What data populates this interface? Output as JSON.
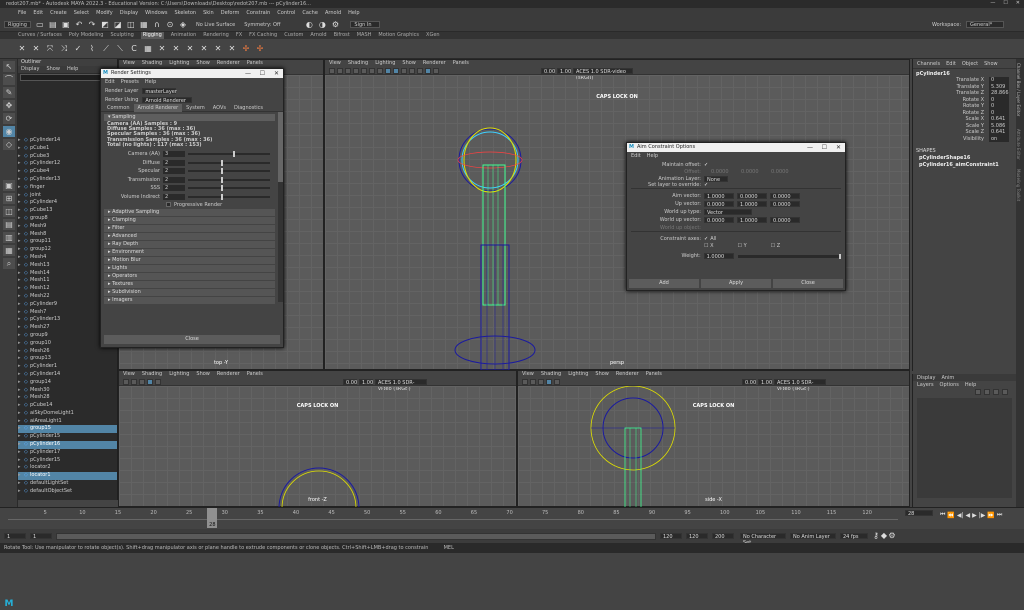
{
  "window": {
    "title": "redot207.mb* - Autodesk MAYA 2022.3 - Educational Version: C:\\Users\\Downloads\\Desktop\\redot207.mb --- pCylinder16..."
  },
  "menubar": [
    "File",
    "Edit",
    "Create",
    "Select",
    "Modify",
    "Display",
    "Windows",
    "Skeleton",
    "Skin",
    "Deform",
    "Constrain",
    "Control",
    "Cache",
    "Arnold",
    "Help"
  ],
  "statusline": {
    "mode": "Rigging",
    "no_live_surface": "No Live Surface",
    "symmetry": "Symmetry: Off",
    "signin": "Sign In",
    "workspace_label": "Workspace:",
    "workspace": "General*"
  },
  "shelf_tabs": [
    "Curves / Surfaces",
    "Poly Modeling",
    "Sculpting",
    "Rigging",
    "Animation",
    "Rendering",
    "FX",
    "FX Caching",
    "Custom",
    "Arnold",
    "Bifrost",
    "MASH",
    "Motion Graphics",
    "XGen"
  ],
  "shelf_active": "Rigging",
  "outliner": {
    "title": "Outliner",
    "menu": [
      "Display",
      "Show",
      "Help"
    ],
    "items": [
      {
        "label": "pCylinder14",
        "sel": false
      },
      {
        "label": "pCube1",
        "sel": false
      },
      {
        "label": "pCube3",
        "sel": false
      },
      {
        "label": "pCylinder12",
        "sel": false
      },
      {
        "label": "pCube4",
        "sel": false
      },
      {
        "label": "pCylinder13",
        "sel": false
      },
      {
        "label": "finger",
        "sel": false
      },
      {
        "label": "joint",
        "sel": false
      },
      {
        "label": "pCylinder4",
        "sel": false
      },
      {
        "label": "pCube13",
        "sel": false
      },
      {
        "label": "group8",
        "sel": false
      },
      {
        "label": "Mesh9",
        "sel": false
      },
      {
        "label": "Mesh8",
        "sel": false
      },
      {
        "label": "group11",
        "sel": false
      },
      {
        "label": "group12",
        "sel": false
      },
      {
        "label": "Mesh4",
        "sel": false
      },
      {
        "label": "Mesh13",
        "sel": false
      },
      {
        "label": "Mesh14",
        "sel": false
      },
      {
        "label": "Mesh11",
        "sel": false
      },
      {
        "label": "Mesh12",
        "sel": false
      },
      {
        "label": "Mesh22",
        "sel": false
      },
      {
        "label": "pCylinder9",
        "sel": false
      },
      {
        "label": "Mesh7",
        "sel": false
      },
      {
        "label": "pCylinder13",
        "sel": false
      },
      {
        "label": "Mesh27",
        "sel": false
      },
      {
        "label": "group9",
        "sel": false
      },
      {
        "label": "group10",
        "sel": false
      },
      {
        "label": "Mesh26",
        "sel": false
      },
      {
        "label": "group13",
        "sel": false
      },
      {
        "label": "pCylinder1",
        "sel": false
      },
      {
        "label": "pCylinder14",
        "sel": false
      },
      {
        "label": "group14",
        "sel": false
      },
      {
        "label": "Mesh30",
        "sel": false
      },
      {
        "label": "Mesh28",
        "sel": false
      },
      {
        "label": "pCube14",
        "sel": false
      },
      {
        "label": "aiSkyDomeLight1",
        "sel": false
      },
      {
        "label": "aiAreaLight1",
        "sel": false
      },
      {
        "label": "group15",
        "sel": true
      },
      {
        "label": "pCylinder15",
        "sel": false
      },
      {
        "label": "pCylinder16",
        "sel": true
      },
      {
        "label": "pCylinder17",
        "sel": false
      },
      {
        "label": "pCylinder15",
        "sel": false
      },
      {
        "label": "locator2",
        "sel": false
      },
      {
        "label": "locator1",
        "sel": true
      },
      {
        "label": "defaultLightSet",
        "sel": false
      },
      {
        "label": "defaultObjectSet",
        "sel": false
      }
    ]
  },
  "viewport_menu": [
    "View",
    "Shading",
    "Lighting",
    "Show",
    "Renderer",
    "Panels"
  ],
  "viewports": {
    "top": {
      "label": "top -Y"
    },
    "persp": {
      "caps": "CAPS LOCK ON",
      "label": "persp",
      "exposure": "0.00",
      "gamma": "1.00",
      "colorspace": "ACES 1.0 SDR-video (sRGB)"
    },
    "front": {
      "caps": "CAPS LOCK ON",
      "label": "front -Z",
      "exposure": "0.00",
      "gamma": "1.00",
      "colorspace": "ACES 1.0 SDR-video (sRGB)"
    },
    "side": {
      "caps": "CAPS LOCK ON",
      "label": "side -X",
      "exposure": "0.00",
      "gamma": "1.00",
      "colorspace": "ACES 1.0 SDR-video (sRGB)"
    }
  },
  "render_settings": {
    "title": "Render Settings",
    "menu": [
      "Edit",
      "Presets",
      "Help"
    ],
    "render_layer_label": "Render Layer",
    "render_layer": "masterLayer",
    "render_using_label": "Render Using",
    "render_using": "Arnold Renderer",
    "tabs": [
      "Common",
      "Arnold Renderer",
      "System",
      "AOVs",
      "Diagnostics"
    ],
    "active_tab": "Arnold Renderer",
    "sampling_header": "Sampling",
    "stats": [
      "Camera (AA) Samples : 9",
      "Diffuse Samples : 36 (max : 36)",
      "Specular Samples : 36 (max : 36)",
      "Transmission Samples : 36 (max : 36)",
      "Total (no lights) : 117 (max : 153)"
    ],
    "sliders": [
      {
        "label": "Camera (AA)",
        "value": "3",
        "level": 0.55
      },
      {
        "label": "Diffuse",
        "value": "2",
        "level": 0.4
      },
      {
        "label": "Specular",
        "value": "2",
        "level": 0.4
      },
      {
        "label": "Transmission",
        "value": "2",
        "level": 0.4
      },
      {
        "label": "SSS",
        "value": "2",
        "level": 0.4
      },
      {
        "label": "Volume Indirect",
        "value": "2",
        "level": 0.4
      }
    ],
    "progressive": "Progressive Render",
    "sections": [
      "Adaptive Sampling",
      "Clamping",
      "Filter",
      "Advanced",
      "Ray Depth",
      "Environment",
      "Motion Blur",
      "Lights",
      "Operators",
      "Textures",
      "Subdivision",
      "Imagers"
    ],
    "close": "Close"
  },
  "aim_constraint": {
    "title": "Aim Constraint Options",
    "menu": [
      "Edit",
      "Help"
    ],
    "maintain_offset": "Maintain offset:",
    "offset_label": "Offset:",
    "offset": [
      "0.0000",
      "0.0000",
      "0.0000"
    ],
    "anim_layer_label": "Animation Layer:",
    "anim_layer": "None",
    "set_layer_override": "Set layer to override:",
    "aim_vector_label": "Aim vector:",
    "aim_vector": [
      "1.0000",
      "0.0000",
      "0.0000"
    ],
    "up_vector_label": "Up vector:",
    "up_vector": [
      "0.0000",
      "1.0000",
      "0.0000"
    ],
    "world_up_type_label": "World up type:",
    "world_up_type": "Vector",
    "world_up_vector_label": "World up vector:",
    "world_up_vector": [
      "0.0000",
      "1.0000",
      "0.0000"
    ],
    "world_up_object": "World up object:",
    "constraint_axes": "Constraint axes:",
    "axes": [
      "All",
      "X",
      "Y",
      "Z"
    ],
    "weight_label": "Weight:",
    "weight": "1.0000",
    "weight_level": 1.0,
    "buttons": [
      "Add",
      "Apply",
      "Close"
    ]
  },
  "channel_box": {
    "tabs": [
      "Channels",
      "Edit",
      "Object",
      "Show"
    ],
    "object": "pCylinder16",
    "channels": [
      {
        "name": "Translate X",
        "value": "0"
      },
      {
        "name": "Translate Y",
        "value": "5.309"
      },
      {
        "name": "Translate Z",
        "value": "28.866"
      },
      {
        "name": "Rotate X",
        "value": "0"
      },
      {
        "name": "Rotate Y",
        "value": "0"
      },
      {
        "name": "Rotate Z",
        "value": "0"
      },
      {
        "name": "Scale X",
        "value": "0.641"
      },
      {
        "name": "Scale Y",
        "value": "5.086"
      },
      {
        "name": "Scale Z",
        "value": "0.641"
      },
      {
        "name": "Visibility",
        "value": "on"
      }
    ],
    "shapes_header": "SHAPES",
    "shapes": [
      "pCylinderShape16",
      "pCylinder16_aimConstraint1"
    ]
  },
  "layer_editor": {
    "tabs": [
      "Display",
      "Anim"
    ],
    "menu": [
      "Layers",
      "Options",
      "Help"
    ]
  },
  "side_tabs": [
    "Channel Box / Layer Editor",
    "Attribute Editor",
    "Modeling Toolkit"
  ],
  "timeslider": {
    "ticks": [
      "5",
      "10",
      "15",
      "20",
      "25",
      "30",
      "35",
      "40",
      "45",
      "50",
      "55",
      "60",
      "65",
      "70",
      "75",
      "80",
      "85",
      "90",
      "95",
      "100",
      "105",
      "110",
      "115",
      "120"
    ],
    "current": "28"
  },
  "rangeslider": {
    "start": "1",
    "inner_start": "1",
    "inner_end": "120",
    "end": "120",
    "end2": "200",
    "no_char_set": "No Character Set",
    "no_anim_layer": "No Anim Layer",
    "fps": "24 fps"
  },
  "helpline": "Rotate Tool: Use manipulator to rotate object(s). Shift+drag manipulator axis or plane handle to extrude components or clone objects. Ctrl+Shift+LMB+drag to constrain rotation to connected edges. Use D or INSERT to change the pivot position and axis orientation.",
  "mel_label": "MEL"
}
